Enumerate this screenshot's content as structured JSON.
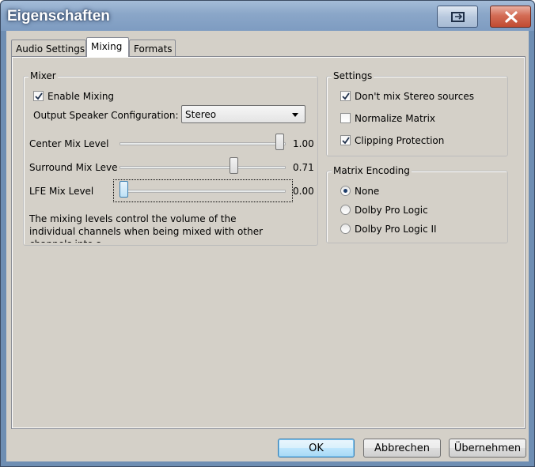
{
  "window": {
    "title": "Eigenschaften"
  },
  "tabs": [
    {
      "label": "Audio Settings",
      "selected": false
    },
    {
      "label": "Mixing",
      "selected": true
    },
    {
      "label": "Formats",
      "selected": false
    }
  ],
  "mixer": {
    "legend": "Mixer",
    "enable_mixing": {
      "label": "Enable Mixing",
      "checked": true
    },
    "output_speaker": {
      "label": "Output Speaker Configuration:",
      "value": "Stereo"
    },
    "sliders": [
      {
        "label": "Center Mix Level",
        "value_text": "1.00",
        "value": 1.0
      },
      {
        "label": "Surround Mix Leve",
        "value_text": "0.71",
        "value": 0.71
      },
      {
        "label": "LFE Mix Level",
        "value_text": "0.00",
        "value": 0.0
      }
    ],
    "description": "The mixing levels control the volume of the individual channels when being mixed with other channels into a"
  },
  "settings": {
    "legend": "Settings",
    "options": [
      {
        "label": "Don't mix Stereo sources",
        "checked": true
      },
      {
        "label": "Normalize Matrix",
        "checked": false
      },
      {
        "label": "Clipping Protection",
        "checked": true
      }
    ]
  },
  "matrix_encoding": {
    "legend": "Matrix Encoding",
    "options": [
      {
        "label": "None",
        "selected": true
      },
      {
        "label": "Dolby Pro Logic",
        "selected": false
      },
      {
        "label": "Dolby Pro Logic II",
        "selected": false
      }
    ]
  },
  "buttons": {
    "ok": "OK",
    "cancel": "Abbrechen",
    "apply": "Übernehmen"
  }
}
